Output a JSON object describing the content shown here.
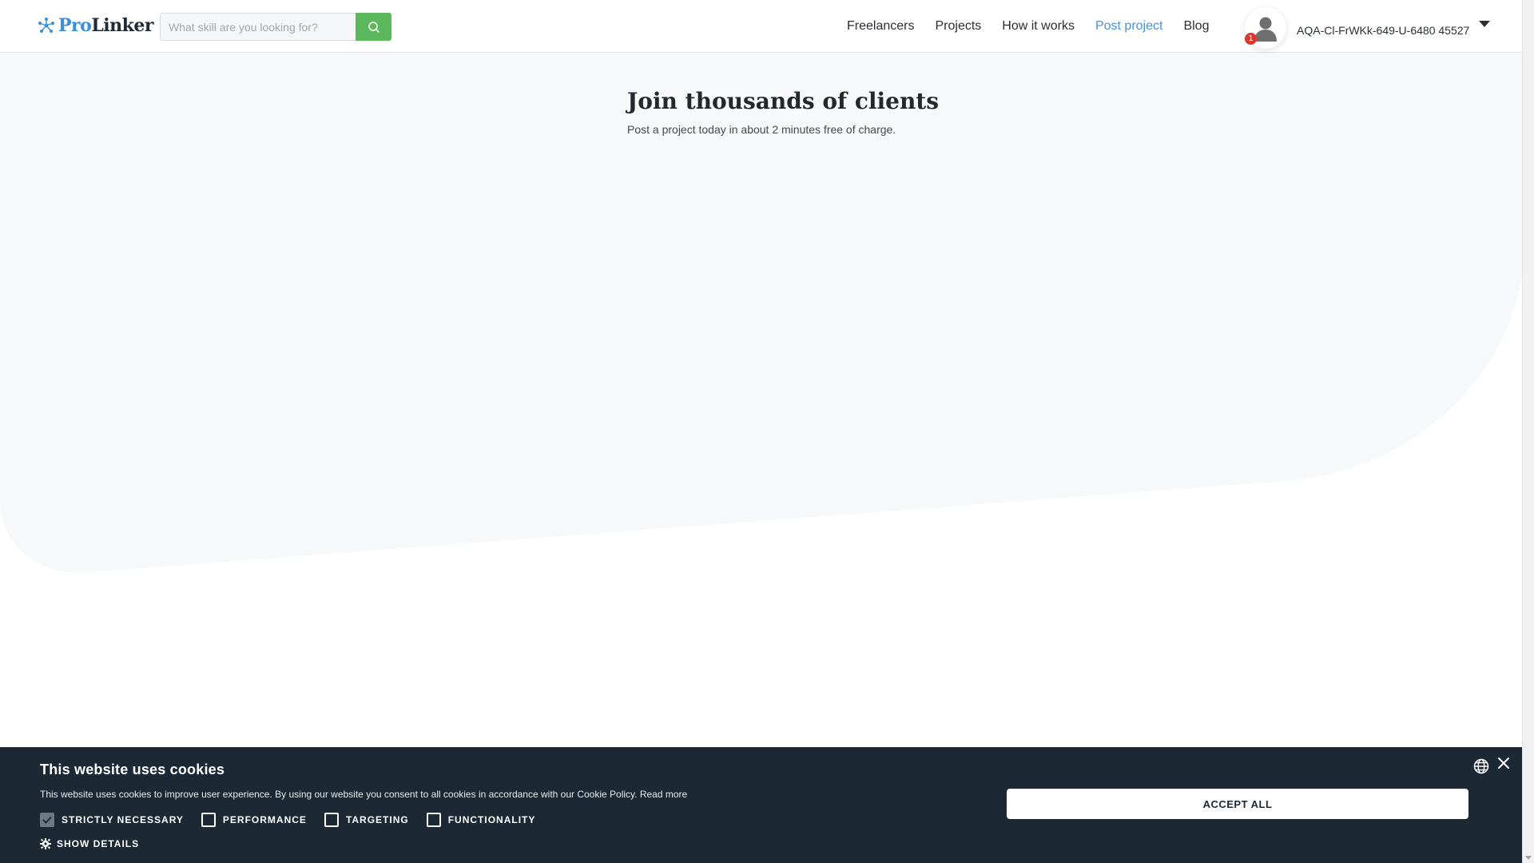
{
  "brand": {
    "logo_part1": "Pro",
    "logo_part2": "Linker",
    "logo_icon": "network-nodes-icon",
    "accent_color": "#3a8fd6",
    "search_button_color": "#5cb85c"
  },
  "search": {
    "placeholder": "What skill are you looking for?",
    "value": "",
    "icon": "search-icon"
  },
  "nav": {
    "items": [
      {
        "label": "Freelancers",
        "active": false
      },
      {
        "label": "Projects",
        "active": false
      },
      {
        "label": "How it works",
        "active": false
      },
      {
        "label": "Post project",
        "active": true
      },
      {
        "label": "Blog",
        "active": false
      }
    ],
    "active_color": "#4a90d9"
  },
  "user": {
    "name": "AQA-Cl-FrWKk-649-U-6480 45527",
    "notification_count": "1",
    "avatar_icon": "user-icon",
    "menu_icon": "caret-down-icon"
  },
  "hero": {
    "title": "Join thousands of clients",
    "subtitle": "Post a project today in about 2 minutes free of charge."
  },
  "cookie_banner": {
    "title": "This website uses cookies",
    "text": "This website uses cookies to improve user experience. By using our website you consent to all cookies in accordance with our Cookie Policy.",
    "read_more": "Read more",
    "options": [
      {
        "label": "STRICTLY NECESSARY",
        "checked": true
      },
      {
        "label": "PERFORMANCE",
        "checked": false
      },
      {
        "label": "TARGETING",
        "checked": false
      },
      {
        "label": "FUNCTIONALITY",
        "checked": false
      }
    ],
    "show_details": "SHOW DETAILS",
    "accept_all": "ACCEPT ALL",
    "background_color": "#1c2833"
  }
}
